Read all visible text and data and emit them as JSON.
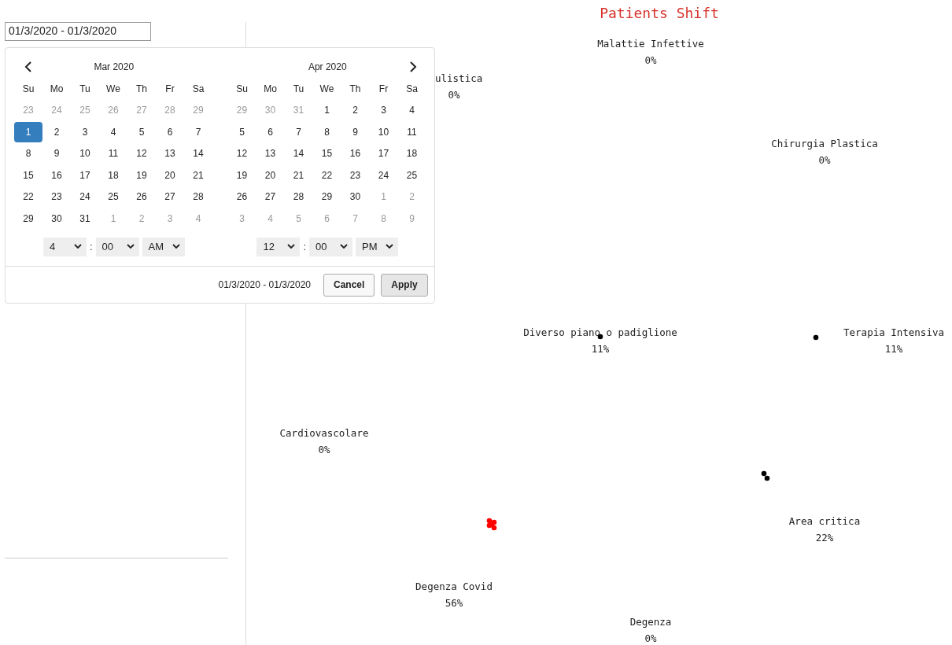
{
  "date_field": {
    "value": "01/3/2020 - 01/3/2020"
  },
  "calendars": [
    {
      "month": "Mar 2020",
      "weekdays": [
        "Su",
        "Mo",
        "Tu",
        "We",
        "Th",
        "Fr",
        "Sa"
      ],
      "weeks": [
        [
          {
            "day": "23",
            "outside": true,
            "selected": false
          },
          {
            "day": "24",
            "outside": true,
            "selected": false
          },
          {
            "day": "25",
            "outside": true,
            "selected": false
          },
          {
            "day": "26",
            "outside": true,
            "selected": false
          },
          {
            "day": "27",
            "outside": true,
            "selected": false
          },
          {
            "day": "28",
            "outside": true,
            "selected": false
          },
          {
            "day": "29",
            "outside": true,
            "selected": false
          }
        ],
        [
          {
            "day": "1",
            "outside": false,
            "selected": true
          },
          {
            "day": "2",
            "outside": false,
            "selected": false
          },
          {
            "day": "3",
            "outside": false,
            "selected": false
          },
          {
            "day": "4",
            "outside": false,
            "selected": false
          },
          {
            "day": "5",
            "outside": false,
            "selected": false
          },
          {
            "day": "6",
            "outside": false,
            "selected": false
          },
          {
            "day": "7",
            "outside": false,
            "selected": false
          }
        ],
        [
          {
            "day": "8",
            "outside": false,
            "selected": false
          },
          {
            "day": "9",
            "outside": false,
            "selected": false
          },
          {
            "day": "10",
            "outside": false,
            "selected": false
          },
          {
            "day": "11",
            "outside": false,
            "selected": false
          },
          {
            "day": "12",
            "outside": false,
            "selected": false
          },
          {
            "day": "13",
            "outside": false,
            "selected": false
          },
          {
            "day": "14",
            "outside": false,
            "selected": false
          }
        ],
        [
          {
            "day": "15",
            "outside": false,
            "selected": false
          },
          {
            "day": "16",
            "outside": false,
            "selected": false
          },
          {
            "day": "17",
            "outside": false,
            "selected": false
          },
          {
            "day": "18",
            "outside": false,
            "selected": false
          },
          {
            "day": "19",
            "outside": false,
            "selected": false
          },
          {
            "day": "20",
            "outside": false,
            "selected": false
          },
          {
            "day": "21",
            "outside": false,
            "selected": false
          }
        ],
        [
          {
            "day": "22",
            "outside": false,
            "selected": false
          },
          {
            "day": "23",
            "outside": false,
            "selected": false
          },
          {
            "day": "24",
            "outside": false,
            "selected": false
          },
          {
            "day": "25",
            "outside": false,
            "selected": false
          },
          {
            "day": "26",
            "outside": false,
            "selected": false
          },
          {
            "day": "27",
            "outside": false,
            "selected": false
          },
          {
            "day": "28",
            "outside": false,
            "selected": false
          }
        ],
        [
          {
            "day": "29",
            "outside": false,
            "selected": false
          },
          {
            "day": "30",
            "outside": false,
            "selected": false
          },
          {
            "day": "31",
            "outside": false,
            "selected": false
          },
          {
            "day": "1",
            "outside": true,
            "selected": false
          },
          {
            "day": "2",
            "outside": true,
            "selected": false
          },
          {
            "day": "3",
            "outside": true,
            "selected": false
          },
          {
            "day": "4",
            "outside": true,
            "selected": false
          }
        ]
      ],
      "time": {
        "hour": "4",
        "separator": ":",
        "minute": "00",
        "ampm": "AM"
      }
    },
    {
      "month": "Apr 2020",
      "weekdays": [
        "Su",
        "Mo",
        "Tu",
        "We",
        "Th",
        "Fr",
        "Sa"
      ],
      "weeks": [
        [
          {
            "day": "29",
            "outside": true,
            "selected": false
          },
          {
            "day": "30",
            "outside": true,
            "selected": false
          },
          {
            "day": "31",
            "outside": true,
            "selected": false
          },
          {
            "day": "1",
            "outside": false,
            "selected": false
          },
          {
            "day": "2",
            "outside": false,
            "selected": false
          },
          {
            "day": "3",
            "outside": false,
            "selected": false
          },
          {
            "day": "4",
            "outside": false,
            "selected": false
          }
        ],
        [
          {
            "day": "5",
            "outside": false,
            "selected": false
          },
          {
            "day": "6",
            "outside": false,
            "selected": false
          },
          {
            "day": "7",
            "outside": false,
            "selected": false
          },
          {
            "day": "8",
            "outside": false,
            "selected": false
          },
          {
            "day": "9",
            "outside": false,
            "selected": false
          },
          {
            "day": "10",
            "outside": false,
            "selected": false
          },
          {
            "day": "11",
            "outside": false,
            "selected": false
          }
        ],
        [
          {
            "day": "12",
            "outside": false,
            "selected": false
          },
          {
            "day": "13",
            "outside": false,
            "selected": false
          },
          {
            "day": "14",
            "outside": false,
            "selected": false
          },
          {
            "day": "15",
            "outside": false,
            "selected": false
          },
          {
            "day": "16",
            "outside": false,
            "selected": false
          },
          {
            "day": "17",
            "outside": false,
            "selected": false
          },
          {
            "day": "18",
            "outside": false,
            "selected": false
          }
        ],
        [
          {
            "day": "19",
            "outside": false,
            "selected": false
          },
          {
            "day": "20",
            "outside": false,
            "selected": false
          },
          {
            "day": "21",
            "outside": false,
            "selected": false
          },
          {
            "day": "22",
            "outside": false,
            "selected": false
          },
          {
            "day": "23",
            "outside": false,
            "selected": false
          },
          {
            "day": "24",
            "outside": false,
            "selected": false
          },
          {
            "day": "25",
            "outside": false,
            "selected": false
          }
        ],
        [
          {
            "day": "26",
            "outside": false,
            "selected": false
          },
          {
            "day": "27",
            "outside": false,
            "selected": false
          },
          {
            "day": "28",
            "outside": false,
            "selected": false
          },
          {
            "day": "29",
            "outside": false,
            "selected": false
          },
          {
            "day": "30",
            "outside": false,
            "selected": false
          },
          {
            "day": "1",
            "outside": true,
            "selected": false
          },
          {
            "day": "2",
            "outside": true,
            "selected": false
          }
        ],
        [
          {
            "day": "3",
            "outside": true,
            "selected": false
          },
          {
            "day": "4",
            "outside": true,
            "selected": false
          },
          {
            "day": "5",
            "outside": true,
            "selected": false
          },
          {
            "day": "6",
            "outside": true,
            "selected": false
          },
          {
            "day": "7",
            "outside": true,
            "selected": false
          },
          {
            "day": "8",
            "outside": true,
            "selected": false
          },
          {
            "day": "9",
            "outside": true,
            "selected": false
          }
        ]
      ],
      "time": {
        "hour": "12",
        "separator": ":",
        "minute": "00",
        "ampm": "PM"
      }
    }
  ],
  "footer": {
    "range": "01/3/2020 - 01/3/2020",
    "buttons": [
      {
        "label": "Cancel",
        "kind": "cancel"
      },
      {
        "label": "Apply",
        "kind": "apply"
      }
    ]
  },
  "chart": {
    "title": "Patients Shift",
    "groups": [
      {
        "label": "Malattie Infettive",
        "value": "0%"
      },
      {
        "label": "ulistica",
        "value": "0%"
      },
      {
        "label": "Chirurgia Plastica",
        "value": "0%"
      },
      {
        "label": "Diverso piano o padiglione",
        "value": "11%",
        "dots": [
          {
            "color": "#000000"
          }
        ]
      },
      {
        "label": "Terapia Intensiva",
        "value": "11%",
        "dots": [
          {
            "color": "#000000"
          }
        ]
      },
      {
        "label": "Cardiovascolare",
        "value": "0%"
      },
      {
        "label": "Area critica",
        "value": "22%",
        "dots": [
          {
            "color": "#000000"
          },
          {
            "color": "#000000"
          }
        ]
      },
      {
        "label": "Degenza Covid",
        "value": "56%",
        "dots": [
          {
            "color": "#ff0000"
          },
          {
            "color": "#ff0000"
          },
          {
            "color": "#ff0000"
          },
          {
            "color": "#ff0000"
          },
          {
            "color": "#ff0000"
          }
        ]
      },
      {
        "label": "Degenza",
        "value": "0%"
      }
    ]
  }
}
